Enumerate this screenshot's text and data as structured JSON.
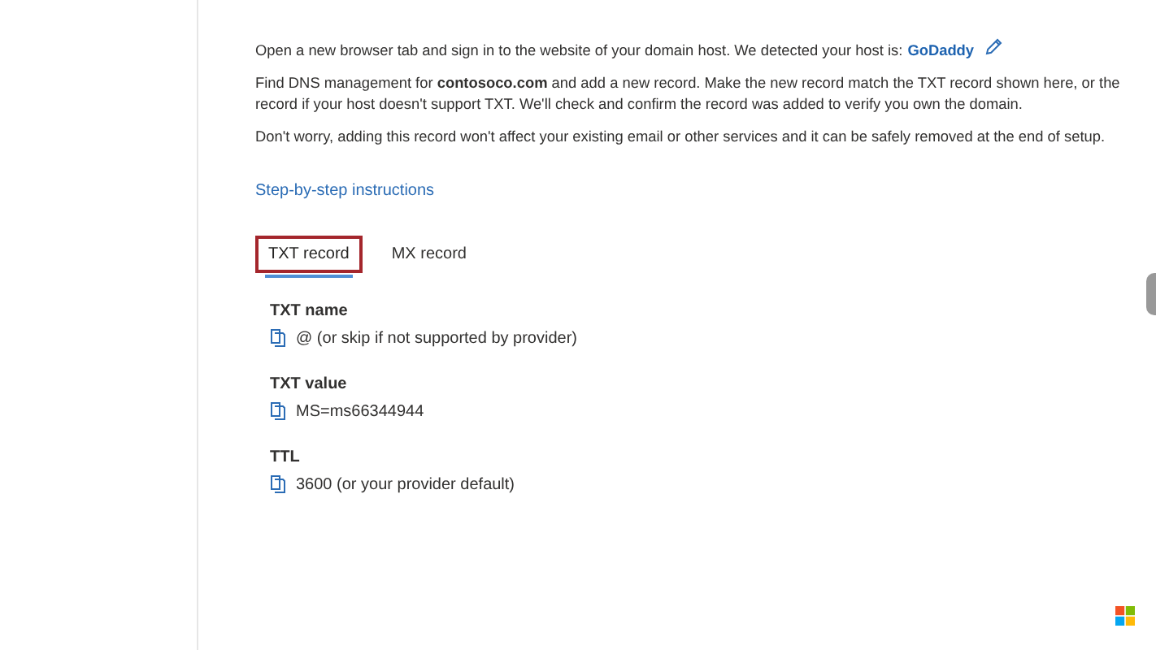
{
  "intro": "Open a new browser tab and sign in to the website of your domain host. We detected your host is:",
  "host_link": "GoDaddy",
  "instructions_lines": [
    "Find DNS management for **contosoco.com** and add a new record. Make the new record match the TXT record shown here, or the",
    "record if your host doesn't support TXT. We'll check and confirm the record was added to verify you own the domain."
  ],
  "reassurance": "Don't worry, adding this record won't affect your existing email or other services and it can be safely removed at the end of setup.",
  "steps_link": "Step-by-step instructions",
  "tabs": [
    {
      "label": "TXT record",
      "selected": true,
      "highlighted": true
    },
    {
      "label": "MX record",
      "selected": false,
      "highlighted": false
    }
  ],
  "fields": [
    {
      "label": "TXT name",
      "value": "@ (or skip if not supported by provider)"
    },
    {
      "label": "TXT value",
      "value": "MS=ms66344944"
    },
    {
      "label": "TTL",
      "value": "3600 (or your provider default)"
    }
  ]
}
